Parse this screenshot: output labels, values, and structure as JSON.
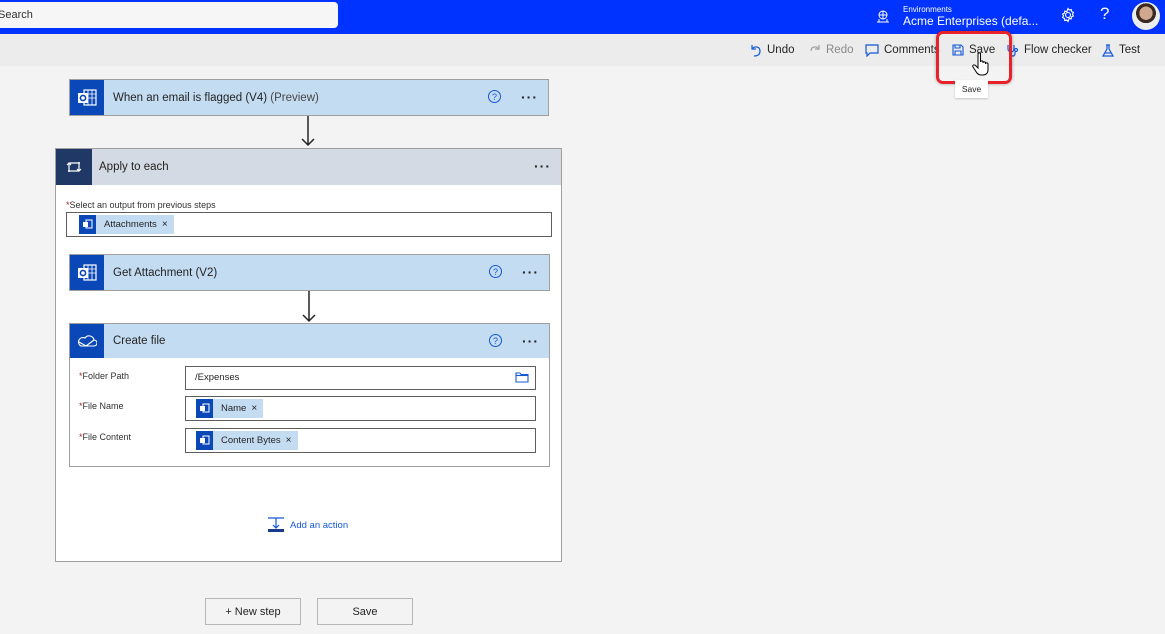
{
  "topbar": {
    "search_placeholder": "Search",
    "environment_label": "Environments",
    "environment_name": "Acme Enterprises (defa...",
    "help_glyph": "?"
  },
  "commandbar": {
    "undo": "Undo",
    "redo": "Redo",
    "comments": "Comments",
    "save": "Save",
    "flow_checker": "Flow checker",
    "test": "Test",
    "tooltip": "Save"
  },
  "flow": {
    "trigger": {
      "title": "When an email is flagged (V4)",
      "subtitle": "(Preview)",
      "icon": "outlook-icon"
    },
    "apply_to_each": {
      "title": "Apply to each",
      "select_label": "Select an output from previous steps",
      "token": "Attachments",
      "icon": "loop-icon"
    },
    "get_attachment": {
      "title": "Get Attachment (V2)",
      "icon": "outlook-icon"
    },
    "create_file": {
      "title": "Create file",
      "icon": "onedrive-icon",
      "fields": [
        {
          "label": "Folder Path",
          "value": "/Expenses"
        },
        {
          "label": "File Name",
          "token": "Name"
        },
        {
          "label": "File Content",
          "token": "Content Bytes"
        }
      ]
    },
    "add_action": "Add an action",
    "required_marker": "*",
    "dots": "···",
    "close_glyph": "×",
    "help_glyph": "?"
  },
  "footer": {
    "new_step": "+ New step",
    "save": "Save"
  },
  "colors": {
    "header_blue": "#0033ff",
    "card_header": "#c3dcf2",
    "icon_blue": "#0a48b8",
    "loop_header": "#d3dae3",
    "loop_icon": "#1f3866",
    "highlight": "#e8222b"
  }
}
